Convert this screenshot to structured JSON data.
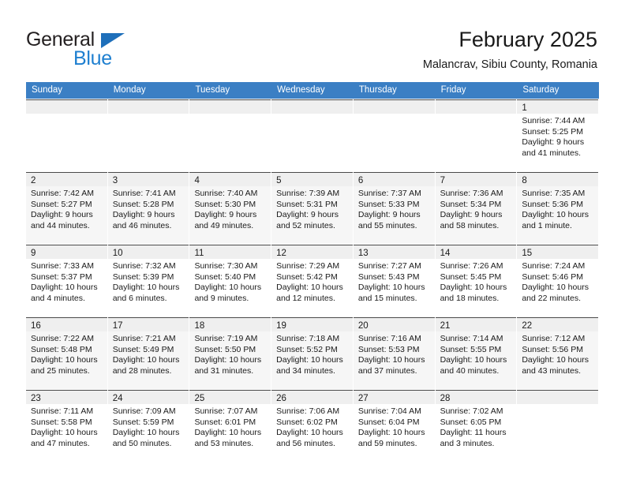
{
  "brand": {
    "word1": "General",
    "word2": "Blue",
    "logo_icon": "triangle-logo-icon",
    "color_dark": "#231f20",
    "color_blue": "#1e7fd0"
  },
  "header": {
    "title": "February 2025",
    "subtitle": "Malancrav, Sibiu County, Romania"
  },
  "theme": {
    "header_band": "#3b7fc4",
    "daynum_band": "#efefef",
    "row_shade": "#f6f6f6",
    "cell_border": "#4a4a4a"
  },
  "weekdays": [
    "Sunday",
    "Monday",
    "Tuesday",
    "Wednesday",
    "Thursday",
    "Friday",
    "Saturday"
  ],
  "weeks": [
    {
      "shaded": false,
      "days": [
        {
          "empty": true
        },
        {
          "empty": true
        },
        {
          "empty": true
        },
        {
          "empty": true
        },
        {
          "empty": true
        },
        {
          "empty": true
        },
        {
          "empty": false,
          "day": "1",
          "sunrise": "Sunrise: 7:44 AM",
          "sunset": "Sunset: 5:25 PM",
          "daylight1": "Daylight: 9 hours",
          "daylight2": "and 41 minutes."
        }
      ]
    },
    {
      "shaded": true,
      "days": [
        {
          "empty": false,
          "day": "2",
          "sunrise": "Sunrise: 7:42 AM",
          "sunset": "Sunset: 5:27 PM",
          "daylight1": "Daylight: 9 hours",
          "daylight2": "and 44 minutes."
        },
        {
          "empty": false,
          "day": "3",
          "sunrise": "Sunrise: 7:41 AM",
          "sunset": "Sunset: 5:28 PM",
          "daylight1": "Daylight: 9 hours",
          "daylight2": "and 46 minutes."
        },
        {
          "empty": false,
          "day": "4",
          "sunrise": "Sunrise: 7:40 AM",
          "sunset": "Sunset: 5:30 PM",
          "daylight1": "Daylight: 9 hours",
          "daylight2": "and 49 minutes."
        },
        {
          "empty": false,
          "day": "5",
          "sunrise": "Sunrise: 7:39 AM",
          "sunset": "Sunset: 5:31 PM",
          "daylight1": "Daylight: 9 hours",
          "daylight2": "and 52 minutes."
        },
        {
          "empty": false,
          "day": "6",
          "sunrise": "Sunrise: 7:37 AM",
          "sunset": "Sunset: 5:33 PM",
          "daylight1": "Daylight: 9 hours",
          "daylight2": "and 55 minutes."
        },
        {
          "empty": false,
          "day": "7",
          "sunrise": "Sunrise: 7:36 AM",
          "sunset": "Sunset: 5:34 PM",
          "daylight1": "Daylight: 9 hours",
          "daylight2": "and 58 minutes."
        },
        {
          "empty": false,
          "day": "8",
          "sunrise": "Sunrise: 7:35 AM",
          "sunset": "Sunset: 5:36 PM",
          "daylight1": "Daylight: 10 hours",
          "daylight2": "and 1 minute."
        }
      ]
    },
    {
      "shaded": false,
      "days": [
        {
          "empty": false,
          "day": "9",
          "sunrise": "Sunrise: 7:33 AM",
          "sunset": "Sunset: 5:37 PM",
          "daylight1": "Daylight: 10 hours",
          "daylight2": "and 4 minutes."
        },
        {
          "empty": false,
          "day": "10",
          "sunrise": "Sunrise: 7:32 AM",
          "sunset": "Sunset: 5:39 PM",
          "daylight1": "Daylight: 10 hours",
          "daylight2": "and 6 minutes."
        },
        {
          "empty": false,
          "day": "11",
          "sunrise": "Sunrise: 7:30 AM",
          "sunset": "Sunset: 5:40 PM",
          "daylight1": "Daylight: 10 hours",
          "daylight2": "and 9 minutes."
        },
        {
          "empty": false,
          "day": "12",
          "sunrise": "Sunrise: 7:29 AM",
          "sunset": "Sunset: 5:42 PM",
          "daylight1": "Daylight: 10 hours",
          "daylight2": "and 12 minutes."
        },
        {
          "empty": false,
          "day": "13",
          "sunrise": "Sunrise: 7:27 AM",
          "sunset": "Sunset: 5:43 PM",
          "daylight1": "Daylight: 10 hours",
          "daylight2": "and 15 minutes."
        },
        {
          "empty": false,
          "day": "14",
          "sunrise": "Sunrise: 7:26 AM",
          "sunset": "Sunset: 5:45 PM",
          "daylight1": "Daylight: 10 hours",
          "daylight2": "and 18 minutes."
        },
        {
          "empty": false,
          "day": "15",
          "sunrise": "Sunrise: 7:24 AM",
          "sunset": "Sunset: 5:46 PM",
          "daylight1": "Daylight: 10 hours",
          "daylight2": "and 22 minutes."
        }
      ]
    },
    {
      "shaded": true,
      "days": [
        {
          "empty": false,
          "day": "16",
          "sunrise": "Sunrise: 7:22 AM",
          "sunset": "Sunset: 5:48 PM",
          "daylight1": "Daylight: 10 hours",
          "daylight2": "and 25 minutes."
        },
        {
          "empty": false,
          "day": "17",
          "sunrise": "Sunrise: 7:21 AM",
          "sunset": "Sunset: 5:49 PM",
          "daylight1": "Daylight: 10 hours",
          "daylight2": "and 28 minutes."
        },
        {
          "empty": false,
          "day": "18",
          "sunrise": "Sunrise: 7:19 AM",
          "sunset": "Sunset: 5:50 PM",
          "daylight1": "Daylight: 10 hours",
          "daylight2": "and 31 minutes."
        },
        {
          "empty": false,
          "day": "19",
          "sunrise": "Sunrise: 7:18 AM",
          "sunset": "Sunset: 5:52 PM",
          "daylight1": "Daylight: 10 hours",
          "daylight2": "and 34 minutes."
        },
        {
          "empty": false,
          "day": "20",
          "sunrise": "Sunrise: 7:16 AM",
          "sunset": "Sunset: 5:53 PM",
          "daylight1": "Daylight: 10 hours",
          "daylight2": "and 37 minutes."
        },
        {
          "empty": false,
          "day": "21",
          "sunrise": "Sunrise: 7:14 AM",
          "sunset": "Sunset: 5:55 PM",
          "daylight1": "Daylight: 10 hours",
          "daylight2": "and 40 minutes."
        },
        {
          "empty": false,
          "day": "22",
          "sunrise": "Sunrise: 7:12 AM",
          "sunset": "Sunset: 5:56 PM",
          "daylight1": "Daylight: 10 hours",
          "daylight2": "and 43 minutes."
        }
      ]
    },
    {
      "shaded": false,
      "days": [
        {
          "empty": false,
          "day": "23",
          "sunrise": "Sunrise: 7:11 AM",
          "sunset": "Sunset: 5:58 PM",
          "daylight1": "Daylight: 10 hours",
          "daylight2": "and 47 minutes."
        },
        {
          "empty": false,
          "day": "24",
          "sunrise": "Sunrise: 7:09 AM",
          "sunset": "Sunset: 5:59 PM",
          "daylight1": "Daylight: 10 hours",
          "daylight2": "and 50 minutes."
        },
        {
          "empty": false,
          "day": "25",
          "sunrise": "Sunrise: 7:07 AM",
          "sunset": "Sunset: 6:01 PM",
          "daylight1": "Daylight: 10 hours",
          "daylight2": "and 53 minutes."
        },
        {
          "empty": false,
          "day": "26",
          "sunrise": "Sunrise: 7:06 AM",
          "sunset": "Sunset: 6:02 PM",
          "daylight1": "Daylight: 10 hours",
          "daylight2": "and 56 minutes."
        },
        {
          "empty": false,
          "day": "27",
          "sunrise": "Sunrise: 7:04 AM",
          "sunset": "Sunset: 6:04 PM",
          "daylight1": "Daylight: 10 hours",
          "daylight2": "and 59 minutes."
        },
        {
          "empty": false,
          "day": "28",
          "sunrise": "Sunrise: 7:02 AM",
          "sunset": "Sunset: 6:05 PM",
          "daylight1": "Daylight: 11 hours",
          "daylight2": "and 3 minutes."
        },
        {
          "empty": true
        }
      ]
    }
  ]
}
